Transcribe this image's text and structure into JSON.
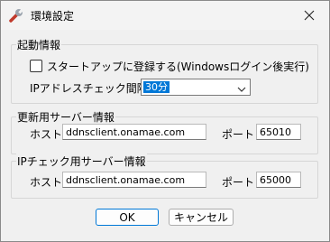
{
  "window": {
    "title": "環境設定"
  },
  "startup": {
    "group_title": "起動情報",
    "autostart_label": "スタートアップに登録する(Windowsログイン後実行)",
    "interval_label": "IPアドレスチェック間隔:",
    "interval_value": "30分"
  },
  "update_server": {
    "group_title": "更新用サーバー情報",
    "host_label": "ホスト",
    "host_value": "ddnsclient.onamae.com",
    "port_label": "ポート",
    "port_value": "65010"
  },
  "ipcheck_server": {
    "group_title": "IPチェック用サーバー情報",
    "host_label": "ホスト",
    "host_value": "ddnsclient.onamae.com",
    "port_label": "ポート",
    "port_value": "65000"
  },
  "buttons": {
    "ok": "OK",
    "cancel": "キャンセル"
  }
}
